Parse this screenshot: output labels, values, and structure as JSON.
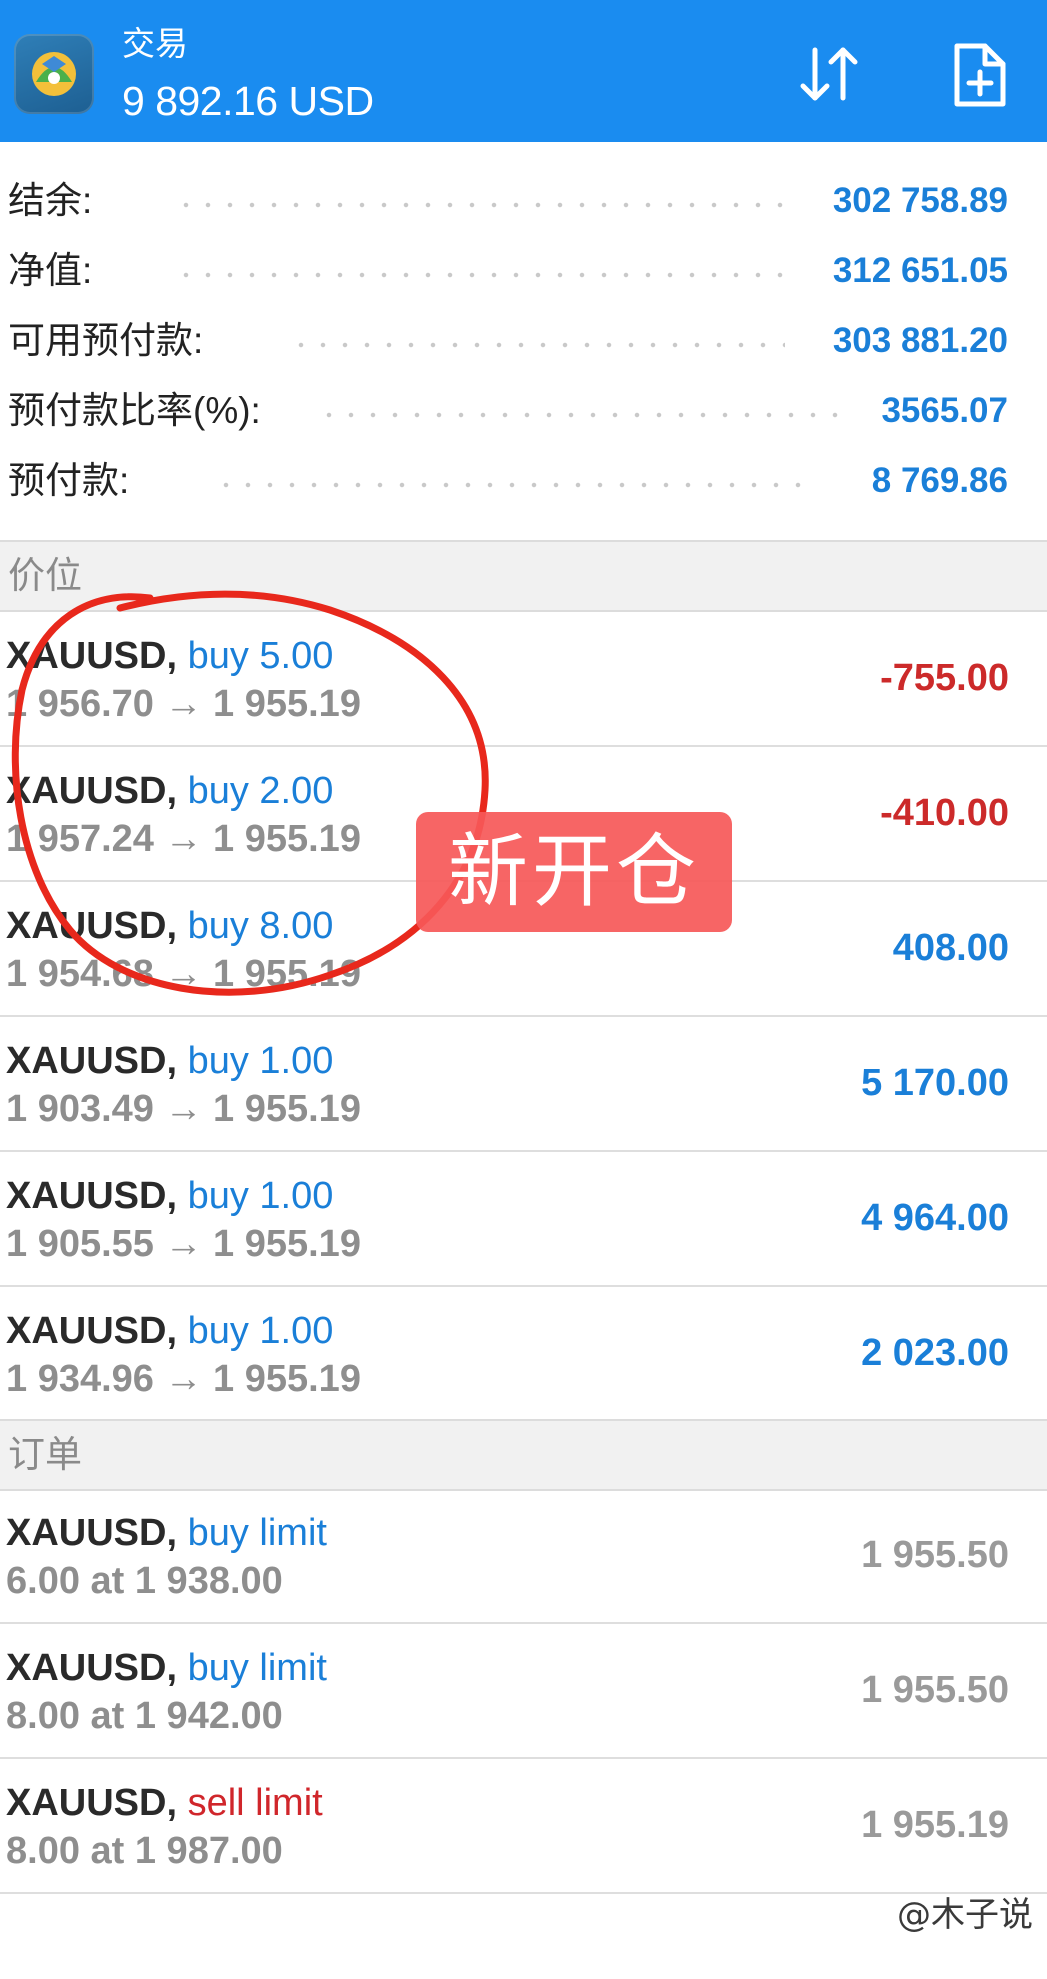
{
  "header": {
    "title": "交易",
    "balance": "9 892.16 USD",
    "accent_color": "#1a8cf0",
    "icons": [
      "app-logo-icon",
      "sort-icon",
      "new-order-icon"
    ]
  },
  "summary": [
    {
      "label": "结余:",
      "value": "302 758.89"
    },
    {
      "label": "净值:",
      "value": "312 651.05"
    },
    {
      "label": "可用预付款:",
      "value": "303 881.20"
    },
    {
      "label": "预付款比率(%):",
      "value": "3565.07"
    },
    {
      "label": "预付款:",
      "value": "8 769.86"
    }
  ],
  "positions_header": "价位",
  "positions": [
    {
      "symbol": "XAUUSD",
      "direction": "buy 5.00",
      "prices": "1 956.70 → 1 955.19",
      "profit": "-755.00",
      "sign": "neg"
    },
    {
      "symbol": "XAUUSD",
      "direction": "buy 2.00",
      "prices": "1 957.24 → 1 955.19",
      "profit": "-410.00",
      "sign": "neg"
    },
    {
      "symbol": "XAUUSD",
      "direction": "buy 8.00",
      "prices": "1 954.68 → 1 955.19",
      "profit": "408.00",
      "sign": "pos"
    },
    {
      "symbol": "XAUUSD",
      "direction": "buy 1.00",
      "prices": "1 903.49 → 1 955.19",
      "profit": "5 170.00",
      "sign": "pos"
    },
    {
      "symbol": "XAUUSD",
      "direction": "buy 1.00",
      "prices": "1 905.55 → 1 955.19",
      "profit": "4 964.00",
      "sign": "pos"
    },
    {
      "symbol": "XAUUSD",
      "direction": "buy 1.00",
      "prices": "1 934.96 → 1 955.19",
      "profit": "2 023.00",
      "sign": "pos"
    }
  ],
  "orders_header": "订单",
  "orders": [
    {
      "symbol": "XAUUSD",
      "type": "buy limit",
      "detail": "6.00 at 1 938.00",
      "price": "1 955.50",
      "kind": "buy"
    },
    {
      "symbol": "XAUUSD",
      "type": "buy limit",
      "detail": "8.00 at 1 942.00",
      "price": "1 955.50",
      "kind": "buy"
    },
    {
      "symbol": "XAUUSD",
      "type": "sell limit",
      "detail": "8.00 at 1 987.00",
      "price": "1 955.19",
      "kind": "sell"
    }
  ],
  "annotation": {
    "label": "新开仓",
    "color": "#f65858"
  },
  "watermark": "@木子说"
}
